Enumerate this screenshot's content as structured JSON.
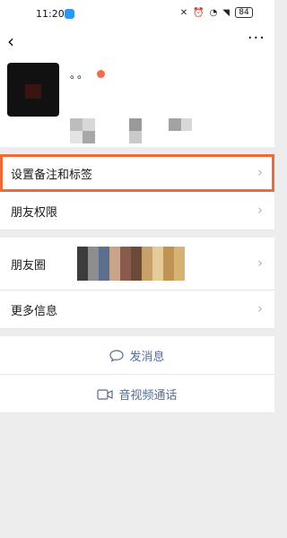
{
  "status_bar": {
    "time": "11:20",
    "battery": "84"
  },
  "nav": {
    "back_icon": "chevron-left-icon",
    "more_label": "···"
  },
  "profile": {
    "name_text": "。。"
  },
  "menu": {
    "remark_label": "设置备注和标签",
    "permissions_label": "朋友权限",
    "moments_label": "朋友圈",
    "more_info_label": "更多信息"
  },
  "actions": {
    "send_message_label": "发消息",
    "video_call_label": "音视频通话"
  },
  "colors": {
    "accent_link": "#576b95",
    "highlight_border": "#f16a35",
    "background": "#ededed"
  }
}
